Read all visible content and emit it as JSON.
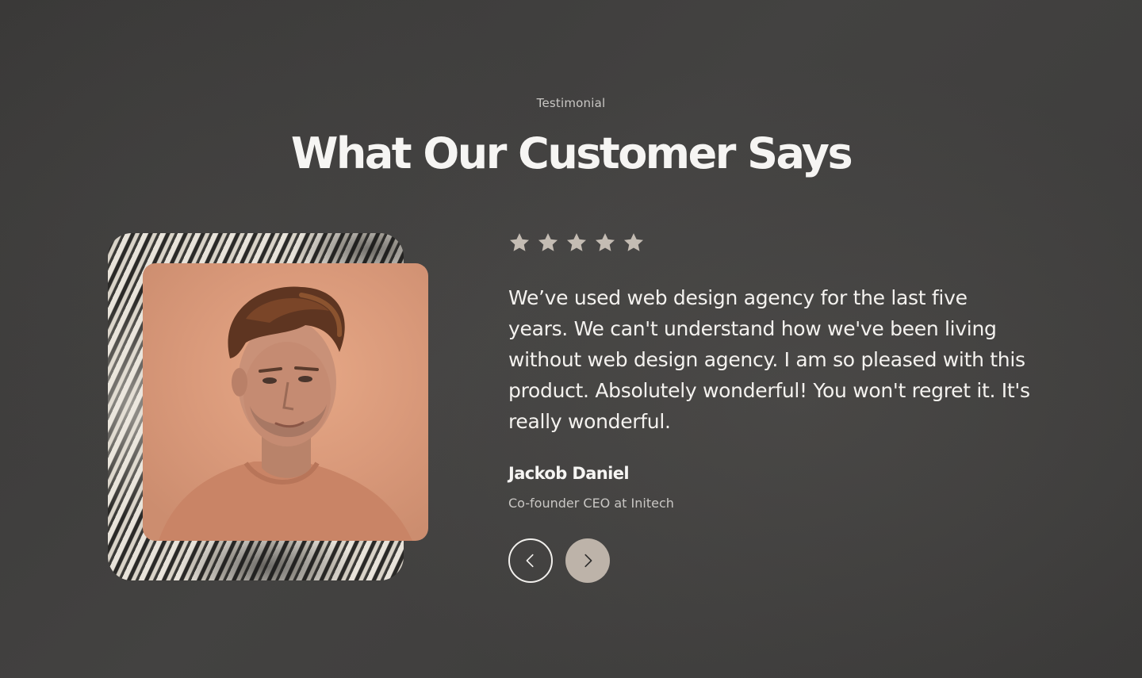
{
  "section": {
    "eyebrow": "Testimonial",
    "title": "What Our Customer Says"
  },
  "testimonial": {
    "rating": 5,
    "rating_max": 5,
    "quote": "We’ve used web design agency for the last five years. We can't understand how we've been living without web design agency. I am so pleased with this product. Absolutely wonderful! You won't regret it. It's really wonderful.",
    "author_name": "Jackob Daniel",
    "author_role": "Co-founder CEO at Initech"
  },
  "navigation": {
    "prev_icon": "chevron-left-icon",
    "next_icon": "chevron-right-icon"
  },
  "colors": {
    "background": "#3f3e3d",
    "star": "#c4bcb3",
    "next_button": "#bdb3a9",
    "portrait_backdrop": "#d9997a"
  }
}
